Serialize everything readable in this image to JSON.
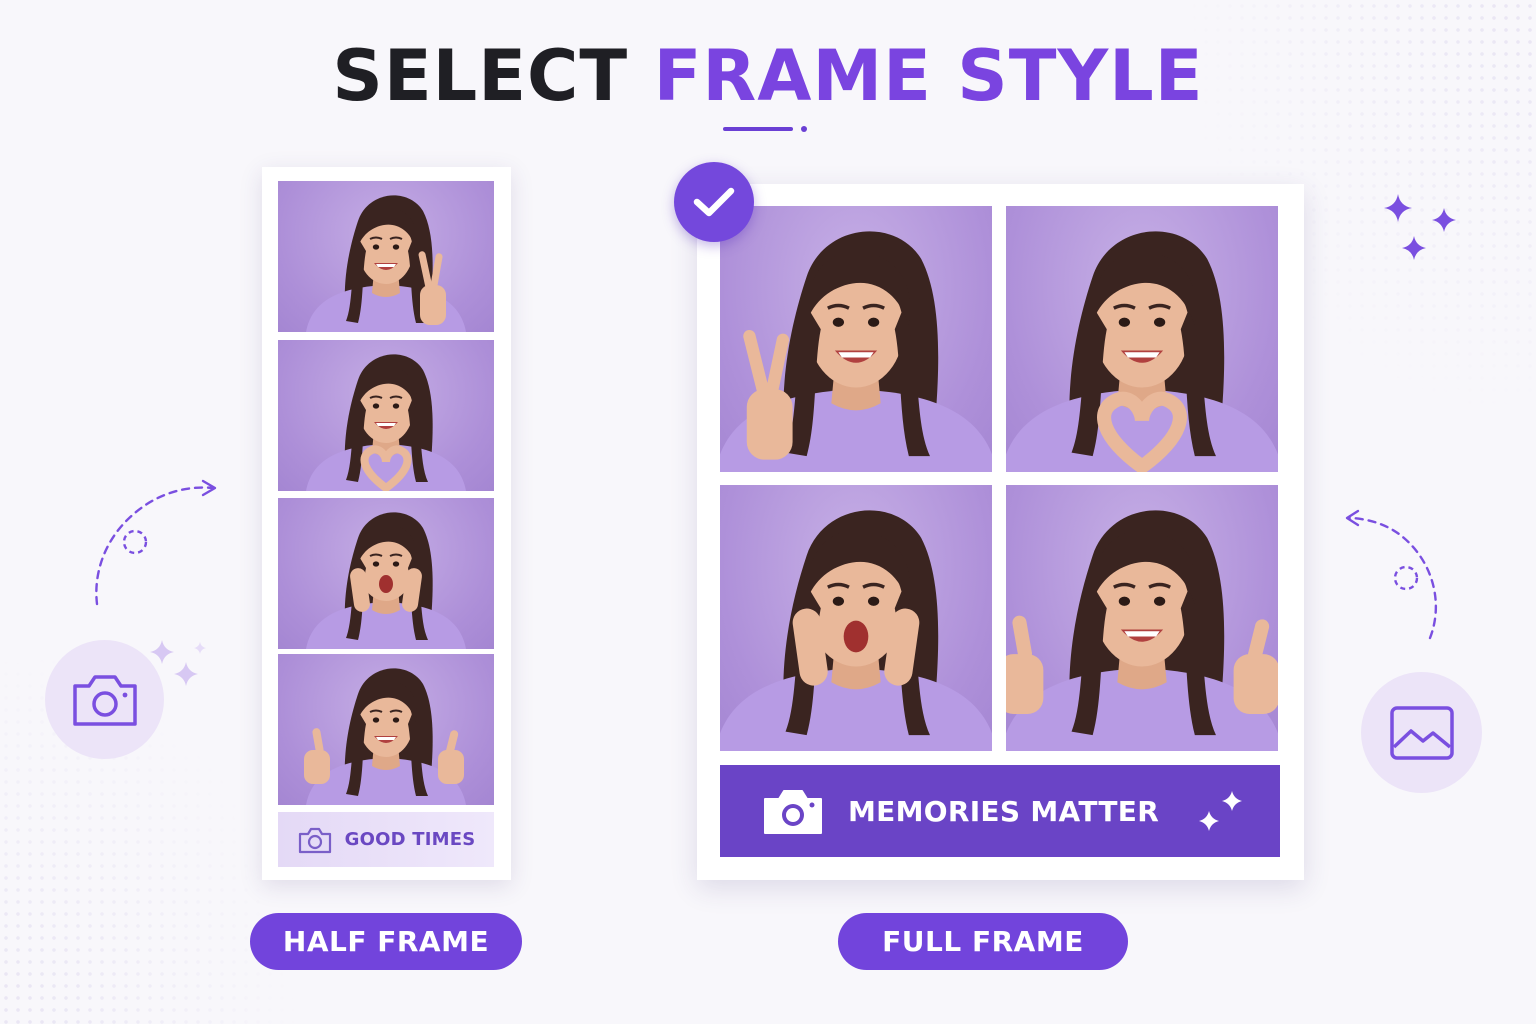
{
  "header": {
    "title_part1": "SELECT",
    "title_part2": "FRAME STYLE"
  },
  "half_frame": {
    "caption": "GOOD TIMES",
    "photos": [
      "peace-sign",
      "heart-hands",
      "surprised",
      "thumbs-up-wink"
    ]
  },
  "full_frame": {
    "caption": "MEMORIES MATTER",
    "selected": true,
    "photos": [
      "peace-sign",
      "heart-hands",
      "surprised",
      "thumbs-up-wink"
    ]
  },
  "options": {
    "half_label": "HALF FRAME",
    "full_label": "FULL FRAME"
  },
  "colors": {
    "accent": "#7244dc",
    "accent_dark": "#6a44c6",
    "title_dark": "#1f1f24",
    "title_accent": "#7a44e0",
    "photo_bg": "#b095da",
    "sweater": "#b79be4",
    "hair": "#3a2420",
    "skin": "#e9b89a"
  },
  "icons": [
    "camera-icon",
    "image-icon",
    "check-icon",
    "sparkle-icon",
    "dashed-arrow-icon"
  ]
}
